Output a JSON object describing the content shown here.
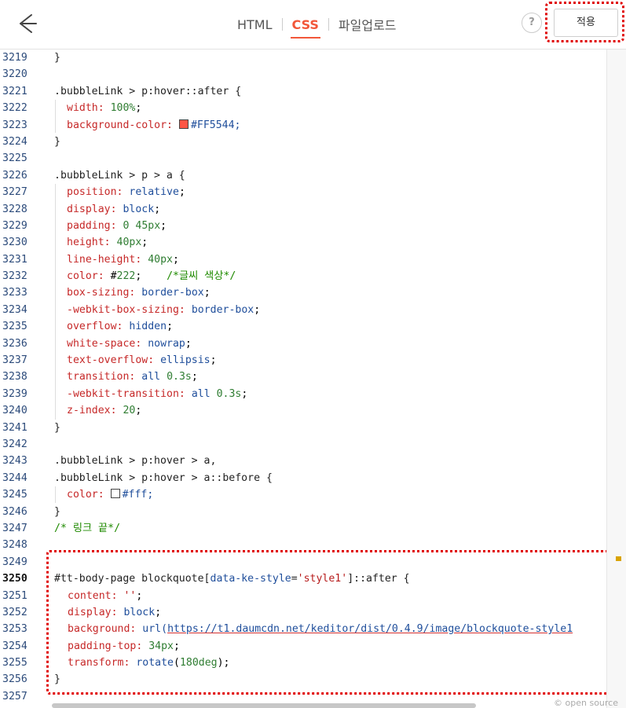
{
  "header": {
    "tabs": [
      {
        "label": "HTML"
      },
      {
        "label": "CSS"
      },
      {
        "label": "파일업로드"
      }
    ],
    "help_label": "?",
    "apply_label": "적용"
  },
  "editor": {
    "line_numbers": [
      "3219",
      "3220",
      "3221",
      "3222",
      "3223",
      "3224",
      "3225",
      "3226",
      "3227",
      "3228",
      "3229",
      "3230",
      "3231",
      "3232",
      "3233",
      "3234",
      "3235",
      "3236",
      "3237",
      "3238",
      "3239",
      "3240",
      "3241",
      "3242",
      "3243",
      "3244",
      "3245",
      "3246",
      "3247",
      "3248",
      "3249",
      "3250",
      "3251",
      "3252",
      "3253",
      "3254",
      "3255",
      "3256",
      "3257"
    ],
    "current_line": "3250",
    "lines": [
      "}",
      "",
      ".bubbleLink > p:hover::after {",
      "width: 100%;",
      "background-color: #FF5544;",
      "}",
      "",
      ".bubbleLink > p > a {",
      "position: relative;",
      "display: block;",
      "padding: 0 45px;",
      "height: 40px;",
      "line-height: 40px;",
      "color: #222;    /*글씨 색상*/",
      "box-sizing: border-box;",
      "-webkit-box-sizing: border-box;",
      "overflow: hidden;",
      "white-space: nowrap;",
      "text-overflow: ellipsis;",
      "transition: all 0.3s;",
      "-webkit-transition: all 0.3s;",
      "z-index: 20;",
      "}",
      "",
      ".bubbleLink > p:hover > a,",
      ".bubbleLink > p:hover > a::before {",
      "color: #fff;",
      "}",
      "/* 링크 끝*/",
      "",
      "",
      "#tt-body-page blockquote[data-ke-style='style1']::after {",
      "content: '';",
      "display: block;",
      "background: url(https://t1.daumcdn.net/keditor/dist/0.4.9/image/blockquote-style1",
      "padding-top: 34px;",
      "transform: rotate(180deg);",
      "}",
      ""
    ],
    "swatch_colors": {
      "red": "#FF5544",
      "white": "#ffffff"
    },
    "open_source_label": "© open source"
  }
}
